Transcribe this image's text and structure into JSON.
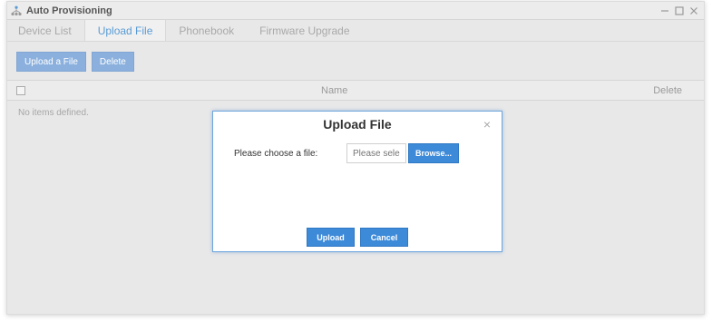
{
  "window": {
    "title": "Auto Provisioning",
    "icons": {
      "app": "network-nodes-icon",
      "minimize": "minimize-icon",
      "maximize": "maximize-icon",
      "close": "close-icon"
    }
  },
  "tabs": [
    {
      "label": "Device List",
      "active": false
    },
    {
      "label": "Upload File",
      "active": true
    },
    {
      "label": "Phonebook",
      "active": false
    },
    {
      "label": "Firmware Upgrade",
      "active": false
    }
  ],
  "toolbar": {
    "upload_label": "Upload a File",
    "delete_label": "Delete"
  },
  "grid": {
    "columns": {
      "name": "Name",
      "delete": "Delete"
    },
    "empty_message": "No items defined."
  },
  "dialog": {
    "title": "Upload File",
    "file_label": "Please choose a file:",
    "file_placeholder": "Please select",
    "browse_label": "Browse...",
    "upload_label": "Upload",
    "cancel_label": "Cancel",
    "close_symbol": "×"
  },
  "colors": {
    "accent": "#3d8ad8",
    "accent_muted": "#8bb0dd",
    "tab_active": "#5a9bd5"
  }
}
